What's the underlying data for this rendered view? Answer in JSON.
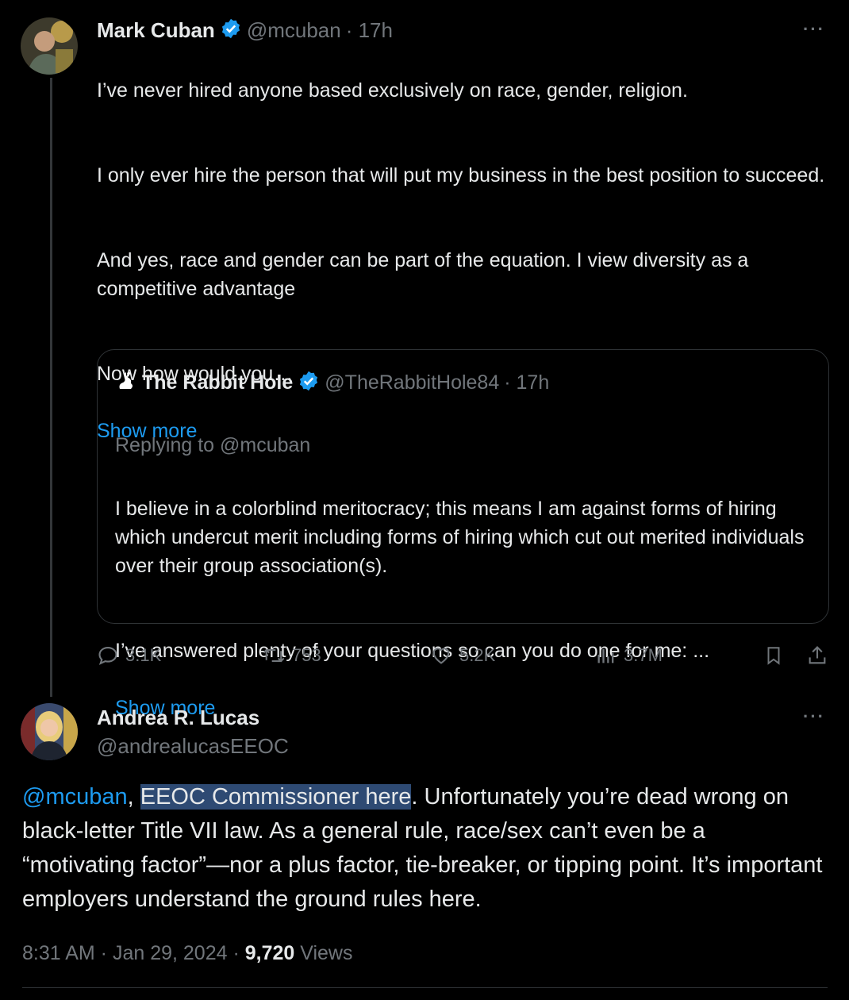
{
  "parent_tweet": {
    "display_name": "Mark Cuban",
    "handle": "@mcuban",
    "time": "· 17h",
    "paragraphs": [
      "I’ve never hired anyone based exclusively on race, gender, religion.",
      "I only ever hire the person that will put my business in the best position to succeed.",
      "And yes, race and gender can be part of the equation. I view diversity as a competitive advantage",
      "Now how would you…"
    ],
    "show_more": "Show more",
    "more_menu": "···",
    "quote": {
      "display_name": "The Rabbit Hole",
      "handle": "@TheRabbitHole84",
      "time": "· 17h",
      "replying_to": "Replying to @mcuban",
      "paragraphs": [
        "I believe in a colorblind meritocracy; this means I am against forms of hiring which undercut merit including forms of hiring which cut out merited individuals over their group association(s).",
        "I’ve answered plenty of your questions so can you do one for me: ..."
      ],
      "show_more": "Show more"
    },
    "actions": {
      "replies": "3.1K",
      "reposts": "753",
      "likes": "5.2K",
      "views": "3.7M"
    }
  },
  "reply_tweet": {
    "display_name": "Andrea R. Lucas",
    "handle": "@andrealucasEEOC",
    "more_menu": "···",
    "text": {
      "mention": "@mcuban",
      "comma": ",",
      "highlighted": "EEOC Commissioner here",
      "rest": ". Unfortunately you’re dead wrong on black-letter Title VII law. As a general rule, race/sex can’t even be a “motivating factor”—nor a plus factor, tie-breaker, or tipping point.  It’s important employers understand the ground rules here."
    },
    "timestamp": "8:31 AM · Jan 29, 2024 · ",
    "view_count": "9,720",
    "views_label": " Views"
  },
  "colors": {
    "background": "#000000",
    "text": "#e7e9ea",
    "muted": "#71767b",
    "link": "#1d9bf0",
    "verified": "#1d9bf0"
  }
}
